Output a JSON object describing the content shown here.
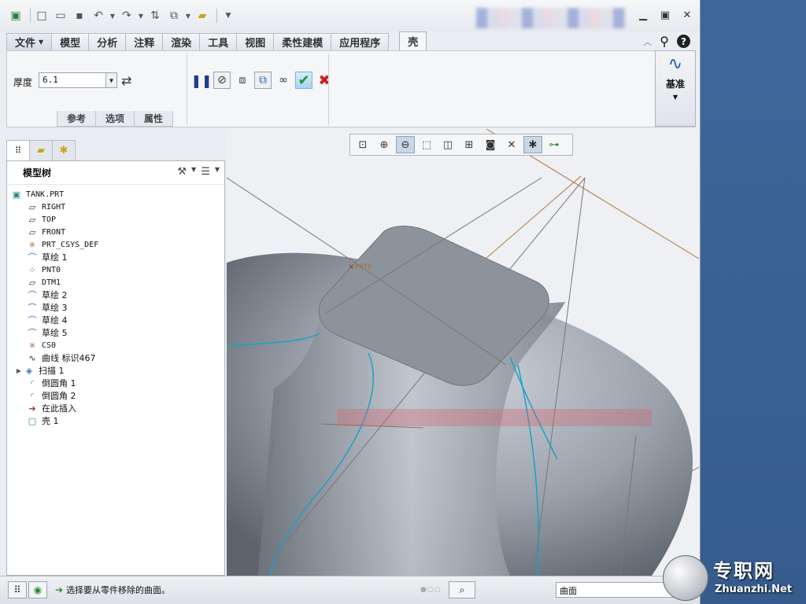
{
  "quick_access": {
    "icons": [
      "app-logo-icon",
      "new-icon",
      "open-icon",
      "save-icon",
      "undo-icon",
      "redo-icon",
      "regenerate-icon",
      "windows-icon",
      "folder-icon",
      "customize-icon"
    ]
  },
  "menu": {
    "tabs": [
      "文件",
      "模型",
      "分析",
      "注释",
      "渲染",
      "工具",
      "视图",
      "柔性建模",
      "应用程序"
    ],
    "active_tab": "壳"
  },
  "ribbon": {
    "thickness_label": "厚度",
    "thickness_value": "6.1",
    "sub_tabs": [
      "参考",
      "选项",
      "属性"
    ],
    "datum_label": "基准"
  },
  "model_tree": {
    "title": "模型树",
    "items": [
      {
        "label": "TANK.PRT",
        "icon": "part-icon",
        "mono": true
      },
      {
        "label": "RIGHT",
        "icon": "datum-plane-icon",
        "mono": true
      },
      {
        "label": "TOP",
        "icon": "datum-plane-icon",
        "mono": true
      },
      {
        "label": "FRONT",
        "icon": "datum-plane-icon",
        "mono": true
      },
      {
        "label": "PRT_CSYS_DEF",
        "icon": "csys-icon",
        "mono": true
      },
      {
        "label": "草绘 1",
        "icon": "sketch-icon",
        "mono": false
      },
      {
        "label": "PNT0",
        "icon": "datum-point-icon",
        "mono": true
      },
      {
        "label": "DTM1",
        "icon": "datum-plane-icon",
        "mono": true
      },
      {
        "label": "草绘 2",
        "icon": "sketch-icon",
        "mono": false
      },
      {
        "label": "草绘 3",
        "icon": "sketch-icon",
        "mono": false
      },
      {
        "label": "草绘 4",
        "icon": "sketch-icon",
        "mono": false
      },
      {
        "label": "草绘 5",
        "icon": "sketch-icon",
        "mono": false
      },
      {
        "label": "CS0",
        "icon": "csys-icon",
        "mono": true
      },
      {
        "label": "曲线 标识467",
        "icon": "curve-icon",
        "mono": false
      },
      {
        "label": "扫描 1",
        "icon": "sweep-icon",
        "mono": false
      },
      {
        "label": "倒圆角 1",
        "icon": "round-icon",
        "mono": false
      },
      {
        "label": "倒圆角 2",
        "icon": "round-icon",
        "mono": false
      },
      {
        "label": "在此插入",
        "icon": "insert-here-icon",
        "mono": false
      },
      {
        "label": "壳 1",
        "icon": "shell-icon",
        "mono": false
      }
    ]
  },
  "viewport": {
    "point_label": "PNT0"
  },
  "status": {
    "message": "选择要从零件移除的曲面。",
    "filter_value": "曲面"
  },
  "watermark": {
    "cn": "专职网",
    "en": "Zhuanzhi.Net"
  },
  "colors": {
    "accept": "#1b9a2a",
    "cancel": "#c81d1d",
    "datum_curve": "#1aa0c8",
    "datum_plane": "#b0783a",
    "model": "#8c939b"
  }
}
